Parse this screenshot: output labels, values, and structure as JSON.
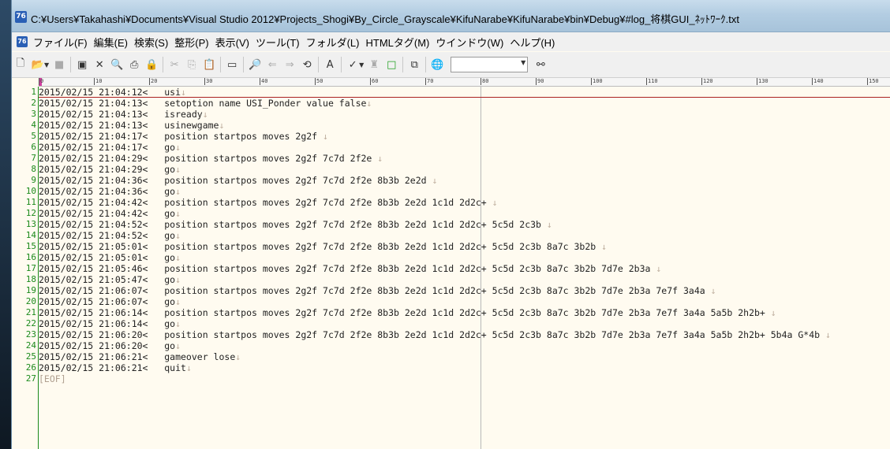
{
  "window": {
    "title": "C:¥Users¥Takahashi¥Documents¥Visual Studio 2012¥Projects_Shogi¥By_Circle_Grayscale¥KifuNarabe¥KifuNarabe¥bin¥Debug¥#log_将棋GUI_ﾈｯﾄﾜｰｸ.txt",
    "app_icon_text": "76"
  },
  "menu": [
    "ファイル(F)",
    "編集(E)",
    "検索(S)",
    "整形(P)",
    "表示(V)",
    "ツール(T)",
    "フォルダ(L)",
    "HTMLタグ(M)",
    "ウインドウ(W)",
    "ヘルプ(H)"
  ],
  "ruler": {
    "labels": [
      "0",
      "10",
      "20",
      "30",
      "40",
      "50",
      "60",
      "70",
      "80",
      "90",
      "100",
      "110",
      "120",
      "130",
      "140",
      "150"
    ]
  },
  "editor": {
    "eol_mark": "↓",
    "eof_mark": "[EOF]",
    "lines": [
      "2015/02/15 21:04:12<   usi",
      "2015/02/15 21:04:13<   setoption name USI_Ponder value false",
      "2015/02/15 21:04:13<   isready",
      "2015/02/15 21:04:13<   usinewgame",
      "2015/02/15 21:04:17<   position startpos moves 2g2f ",
      "2015/02/15 21:04:17<   go",
      "2015/02/15 21:04:29<   position startpos moves 2g2f 7c7d 2f2e ",
      "2015/02/15 21:04:29<   go",
      "2015/02/15 21:04:36<   position startpos moves 2g2f 7c7d 2f2e 8b3b 2e2d ",
      "2015/02/15 21:04:36<   go",
      "2015/02/15 21:04:42<   position startpos moves 2g2f 7c7d 2f2e 8b3b 2e2d 1c1d 2d2c+ ",
      "2015/02/15 21:04:42<   go",
      "2015/02/15 21:04:52<   position startpos moves 2g2f 7c7d 2f2e 8b3b 2e2d 1c1d 2d2c+ 5c5d 2c3b ",
      "2015/02/15 21:04:52<   go",
      "2015/02/15 21:05:01<   position startpos moves 2g2f 7c7d 2f2e 8b3b 2e2d 1c1d 2d2c+ 5c5d 2c3b 8a7c 3b2b ",
      "2015/02/15 21:05:01<   go",
      "2015/02/15 21:05:46<   position startpos moves 2g2f 7c7d 2f2e 8b3b 2e2d 1c1d 2d2c+ 5c5d 2c3b 8a7c 3b2b 7d7e 2b3a ",
      "2015/02/15 21:05:47<   go",
      "2015/02/15 21:06:07<   position startpos moves 2g2f 7c7d 2f2e 8b3b 2e2d 1c1d 2d2c+ 5c5d 2c3b 8a7c 3b2b 7d7e 2b3a 7e7f 3a4a ",
      "2015/02/15 21:06:07<   go",
      "2015/02/15 21:06:14<   position startpos moves 2g2f 7c7d 2f2e 8b3b 2e2d 1c1d 2d2c+ 5c5d 2c3b 8a7c 3b2b 7d7e 2b3a 7e7f 3a4a 5a5b 2h2b+ ",
      "2015/02/15 21:06:14<   go",
      "2015/02/15 21:06:20<   position startpos moves 2g2f 7c7d 2f2e 8b3b 2e2d 1c1d 2d2c+ 5c5d 2c3b 8a7c 3b2b 7d7e 2b3a 7e7f 3a4a 5a5b 2h2b+ 5b4a G*4b ",
      "2015/02/15 21:06:20<   go",
      "2015/02/15 21:06:21<   gameover lose",
      "2015/02/15 21:06:21<   quit"
    ]
  },
  "toolbar": {
    "icons": [
      "new-file-icon",
      "open-folder-icon",
      "save-icon",
      "save-as-icon",
      "close-icon",
      "print-preview-icon",
      "print-icon",
      "lock-icon",
      "cut-icon",
      "copy-icon",
      "paste-icon",
      "window-icon",
      "search-icon",
      "find-prev-icon",
      "find-next-icon",
      "replace-icon",
      "grep-icon",
      "spell-check-icon",
      "macro-icon",
      "outline-icon",
      "browser-icon",
      "binoculars-icon"
    ]
  }
}
